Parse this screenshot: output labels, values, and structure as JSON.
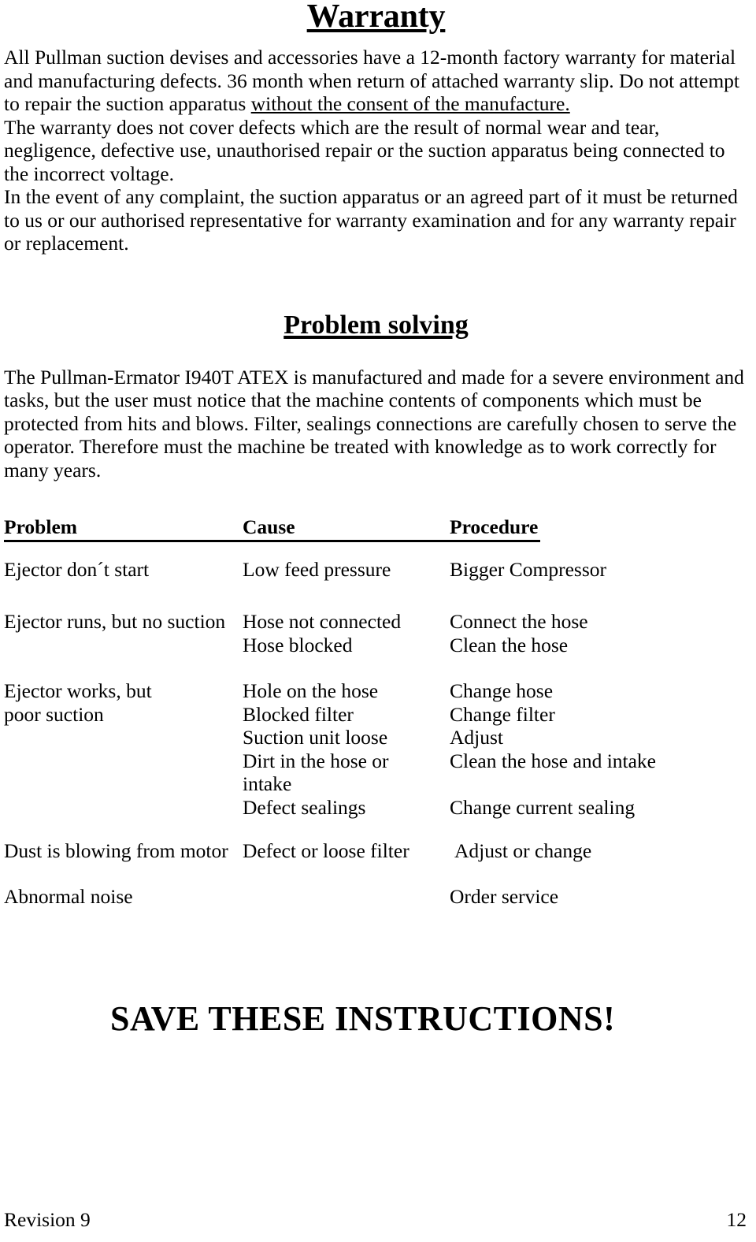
{
  "document": {
    "warranty_heading": "Warranty",
    "warranty_paragraphs": [
      {
        "runs": [
          {
            "text": " All Pullman suction devises and accessories have a 12-month factory warranty for material and manufacturing defects. 36 month when return of attached warranty slip. Do not attempt to repair the suction apparatus ",
            "underline": false
          },
          {
            "text": "without the consent of the manufacture.",
            "underline": true
          }
        ]
      },
      {
        "runs": [
          {
            "text": "The warranty does not cover defects which are the result of normal wear and tear, negligence, defective use, unauthorised repair or the suction apparatus being connected to the incorrect voltage.",
            "underline": false
          }
        ]
      },
      {
        "runs": [
          {
            "text": "In the event of any complaint, the suction apparatus or an agreed part of it must be returned to us or our authorised representative for warranty examination and for any warranty repair or replacement.",
            "underline": false
          }
        ]
      }
    ],
    "problem_solving_heading": "Problem solving",
    "problem_solving_paragraph": "The Pullman-Ermator I940T ATEX is manufactured and made for a severe environment and tasks, but the user must notice that the machine contents of components which must be protected from hits and blows. Filter, sealings connections are carefully chosen to serve the operator. Therefore must the machine be treated with knowledge as to work correctly for many years.",
    "table": {
      "headers": {
        "problem": "Problem",
        "cause": "Cause",
        "procedure": "Procedure"
      },
      "rows": [
        {
          "problem": "Ejector don´t start",
          "cause": "Low feed pressure",
          "procedure": "Bigger Compressor"
        },
        {
          "problem": "Ejector runs, but no suction",
          "cause": "Hose not connected\nHose blocked",
          "procedure": "Connect the hose\nClean the hose"
        },
        {
          "problem": "Ejector works, but\npoor suction",
          "cause": "Hole on the hose\nBlocked filter\nSuction unit loose\nDirt in the hose or\nintake\nDefect sealings",
          "procedure": "Change hose\nChange filter\nAdjust\nClean the hose and intake\n\nChange current sealing"
        },
        {
          "problem": "Dust is blowing from motor",
          "cause": "Defect or loose filter",
          "procedure": "Adjust or change"
        },
        {
          "problem": "Abnormal noise",
          "cause": "",
          "procedure": "Order service"
        }
      ]
    },
    "save_instructions": "SAVE THESE INSTRUCTIONS!",
    "footer": {
      "revision": "Revision 9",
      "page_number": "12"
    }
  }
}
